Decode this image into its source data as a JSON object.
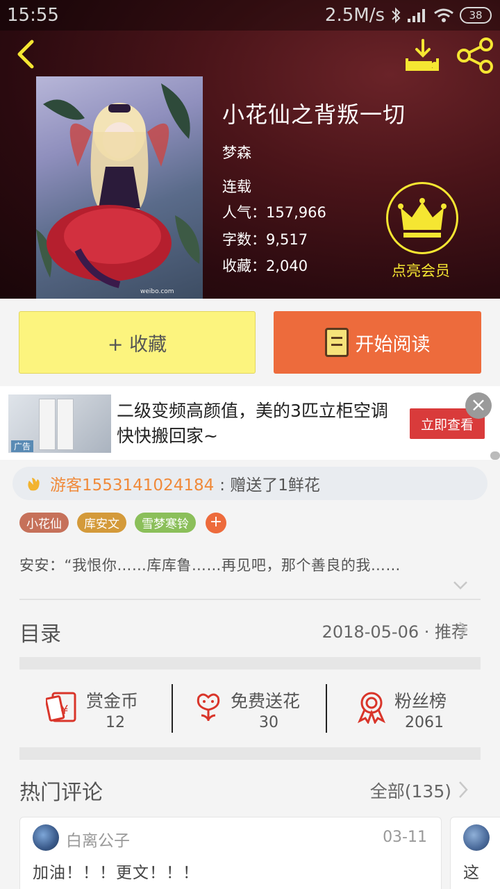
{
  "status_bar": {
    "time": "15:55",
    "speed": "2.5M/s",
    "battery": "38"
  },
  "book": {
    "title": "小花仙之背叛一切",
    "author": "梦森",
    "status": "连载",
    "popularity_label": "人气：",
    "popularity": "157,966",
    "words_label": "字数：",
    "words": "9,517",
    "favorites_label": "收藏：",
    "favorites": "2,040"
  },
  "vip": {
    "label": "点亮会员"
  },
  "actions": {
    "collect": "+ 收藏",
    "read": "开始阅读"
  },
  "ad": {
    "tag": "广告",
    "text": "二级变频高颜值，美的3匹立柜空调快快搬回家~",
    "button": "立即查看"
  },
  "gift": {
    "user": "游客1553141024184",
    "text": ": 赠送了1鲜花"
  },
  "tags": [
    {
      "label": "小花仙",
      "color": "#c6715a"
    },
    {
      "label": "库安文",
      "color": "#d49a3a"
    },
    {
      "label": "雪梦寒铃",
      "color": "#8bbf5a"
    }
  ],
  "tag_add": "+",
  "intro": "安安：“我恨你……库库鲁……再见吧，那个善良的我……",
  "toc": {
    "title": "目录",
    "right": "2018-05-06 · 推荐"
  },
  "stats": [
    {
      "label": "赏金币",
      "value": "12",
      "icon": "red-envelope-icon"
    },
    {
      "label": "免费送花",
      "value": "30",
      "icon": "flower-icon"
    },
    {
      "label": "粉丝榜",
      "value": "2061",
      "icon": "medal-icon"
    }
  ],
  "comments": {
    "title": "热门评论",
    "all": "全部(135)",
    "items": [
      {
        "user": "白离公子",
        "date": "03-11",
        "text": "加油！！！更文！！！"
      },
      {
        "text": "这"
      }
    ]
  },
  "colors": {
    "accent": "#ed6b3c",
    "yellow": "#fcf47e",
    "vip": "#f5e632"
  }
}
